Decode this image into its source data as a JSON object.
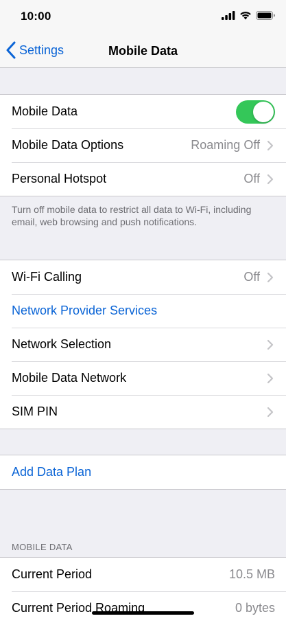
{
  "status_bar": {
    "time": "10:00"
  },
  "nav": {
    "back_label": "Settings",
    "title": "Mobile Data"
  },
  "group1": {
    "mobile_data": {
      "label": "Mobile Data",
      "enabled": true
    },
    "mobile_data_options": {
      "label": "Mobile Data Options",
      "value": "Roaming Off"
    },
    "personal_hotspot": {
      "label": "Personal Hotspot",
      "value": "Off"
    }
  },
  "footer_note": "Turn off mobile data to restrict all data to Wi-Fi, including email, web browsing and push notifications.",
  "group2": {
    "wifi_calling": {
      "label": "Wi-Fi Calling",
      "value": "Off"
    },
    "network_provider_services": {
      "label": "Network Provider Services"
    },
    "network_selection": {
      "label": "Network Selection"
    },
    "mobile_data_network": {
      "label": "Mobile Data Network"
    },
    "sim_pin": {
      "label": "SIM PIN"
    }
  },
  "group3": {
    "add_data_plan": {
      "label": "Add Data Plan"
    }
  },
  "usage_section": {
    "header": "MOBILE DATA",
    "current_period": {
      "label": "Current Period",
      "value": "10.5 MB"
    },
    "current_period_roaming": {
      "label": "Current Period Roaming",
      "value": "0 bytes"
    }
  },
  "colors": {
    "accent": "#0a64d6",
    "toggle_on": "#34c759",
    "background": "#efeff4",
    "secondary_text": "#8a8a8e"
  }
}
